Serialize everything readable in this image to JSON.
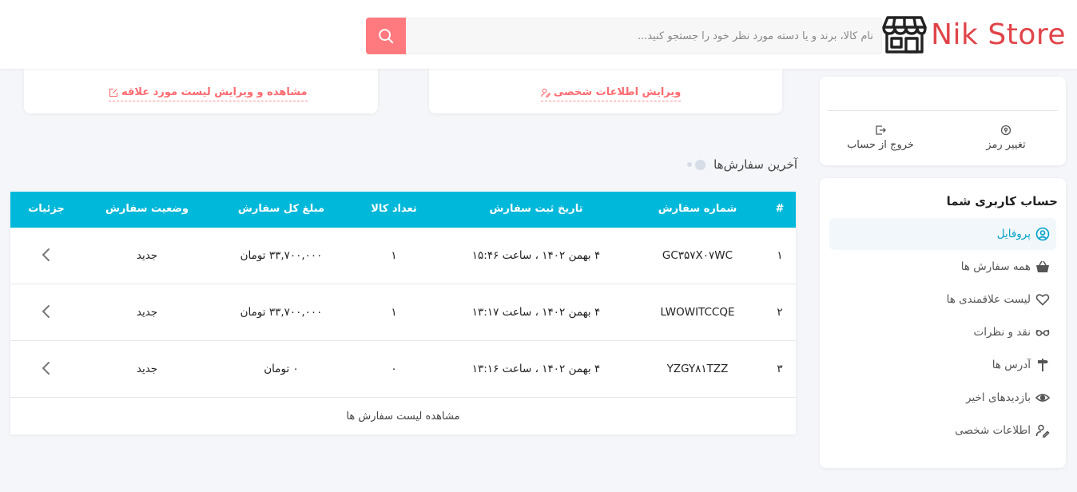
{
  "header": {
    "logo_text": "Nik Store",
    "search_placeholder": "نام کالا، برند و یا دسته مورد نظر خود را جستجو کنید...",
    "accent_color": "#e0454a",
    "search_button_color": "#ff7a7f"
  },
  "sidebar": {
    "actions": [
      {
        "label": "تغییر رمز",
        "icon": "key-icon"
      },
      {
        "label": "خروج از حساب",
        "icon": "logout-icon"
      }
    ],
    "title": "حساب کاربری شما",
    "items": [
      {
        "label": "پروفایل",
        "icon": "user-circle-icon",
        "active": true
      },
      {
        "label": "همه سفارش ها",
        "icon": "basket-icon"
      },
      {
        "label": "لیست علاقمندی ها",
        "icon": "heart-icon"
      },
      {
        "label": "نقد و نظرات",
        "icon": "glasses-icon"
      },
      {
        "label": "آدرس ها",
        "icon": "signpost-icon"
      },
      {
        "label": "بازدیدهای اخیر",
        "icon": "eye-icon"
      },
      {
        "label": "اطلاعات شخصی",
        "icon": "user-edit-icon"
      }
    ]
  },
  "cards": {
    "edit_personal_info": "ویرایش اطلاعات شخصی",
    "wishlist_link": "مشاهده و ویرایش لیست مورد علاقه"
  },
  "orders": {
    "section_title": "آخرین سفارش‌ها",
    "columns": [
      "#",
      "شماره سفارش",
      "تاریخ ثبت سفارش",
      "تعداد کالا",
      "مبلغ کل سفارش",
      "وضعیت سفارش",
      "جزئیات"
    ],
    "rows": [
      {
        "index": "۱",
        "order_no": "GC۳۵۷X۰۷WC",
        "date": "۴ بهمن ۱۴۰۲ ، ساعت ۱۵:۴۶",
        "qty": "۱",
        "total": "۳۳,۷۰۰,۰۰۰ تومان",
        "status": "جدید"
      },
      {
        "index": "۲",
        "order_no": "LWOWITCCQE",
        "date": "۴ بهمن ۱۴۰۲ ، ساعت ۱۳:۱۷",
        "qty": "۱",
        "total": "۳۳,۷۰۰,۰۰۰ تومان",
        "status": "جدید"
      },
      {
        "index": "۳",
        "order_no": "YZGY۸۱TZZ",
        "date": "۴ بهمن ۱۴۰۲ ، ساعت ۱۳:۱۶",
        "qty": "۰",
        "total": "۰ تومان",
        "status": "جدید"
      }
    ],
    "view_all": "مشاهده لیست سفارش ها",
    "header_color": "#00b8d9"
  }
}
